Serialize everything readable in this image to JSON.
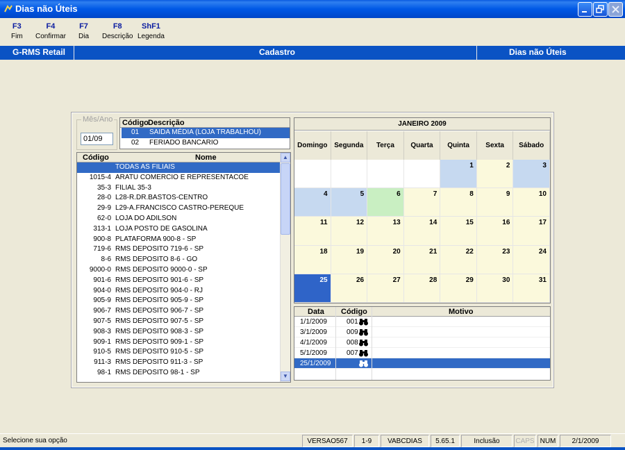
{
  "window": {
    "title": "Dias não Úteis",
    "buttons": [
      "minimize",
      "restore",
      "close"
    ]
  },
  "toolbar": [
    {
      "key": "F3",
      "label": "Fim"
    },
    {
      "key": "F4",
      "label": "Confirmar"
    },
    {
      "key": "F7",
      "label": "Dia"
    },
    {
      "key": "F8",
      "label": "Descrição"
    },
    {
      "key": "ShF1",
      "label": "Legenda"
    }
  ],
  "header": {
    "left": "G-RMS Retail",
    "center": "Cadastro",
    "right": "Dias não Úteis"
  },
  "mesano": {
    "legend": "Mês/Ano",
    "value": "01/09"
  },
  "motivo_tipos": {
    "headers": [
      "Código",
      "Descrição"
    ],
    "rows": [
      {
        "codigo": "01",
        "descricao": "SAIDA MÉDIA (LOJA TRABALHOU)",
        "selected": true
      },
      {
        "codigo": "02",
        "descricao": "FERIADO BANCARIO",
        "selected": false
      }
    ]
  },
  "filiais": {
    "headers": [
      "Código",
      "Nome"
    ],
    "rows": [
      {
        "codigo": "",
        "nome": "TODAS AS FILIAIS",
        "selected": true
      },
      {
        "codigo": "1015-4",
        "nome": "ARATU COMERCIO E REPRESENTACOE"
      },
      {
        "codigo": "35-3",
        "nome": "FILIAL 35-3"
      },
      {
        "codigo": "28-0",
        "nome": "L28-R.DR.BASTOS-CENTRO"
      },
      {
        "codigo": "29-9",
        "nome": "L29-A.FRANCISCO CASTRO-PEREQUE"
      },
      {
        "codigo": "62-0",
        "nome": "LOJA DO ADILSON"
      },
      {
        "codigo": "313-1",
        "nome": "LOJA POSTO DE GASOLINA"
      },
      {
        "codigo": "900-8",
        "nome": "PLATAFORMA 900-8 - SP"
      },
      {
        "codigo": "719-6",
        "nome": "RMS DEPOSITO 719-6 - SP"
      },
      {
        "codigo": "8-6",
        "nome": "RMS DEPOSITO 8-6 - GO"
      },
      {
        "codigo": "9000-0",
        "nome": "RMS DEPOSITO 9000-0 - SP"
      },
      {
        "codigo": "901-6",
        "nome": "RMS DEPOSITO 901-6 - SP"
      },
      {
        "codigo": "904-0",
        "nome": "RMS DEPOSITO 904-0 - RJ"
      },
      {
        "codigo": "905-9",
        "nome": "RMS DEPOSITO 905-9 - SP"
      },
      {
        "codigo": "906-7",
        "nome": "RMS DEPOSITO 906-7 - SP"
      },
      {
        "codigo": "907-5",
        "nome": "RMS DEPOSITO 907-5 - SP"
      },
      {
        "codigo": "908-3",
        "nome": "RMS DEPOSITO 908-3 - SP"
      },
      {
        "codigo": "909-1",
        "nome": "RMS DEPOSITO 909-1 - SP"
      },
      {
        "codigo": "910-5",
        "nome": "RMS DEPOSITO 910-5 - SP"
      },
      {
        "codigo": "911-3",
        "nome": "RMS DEPOSITO 911-3 - SP"
      },
      {
        "codigo": "98-1",
        "nome": "RMS DEPOSITO 98-1 - SP"
      }
    ]
  },
  "calendar": {
    "title": "JANEIRO 2009",
    "daynames": [
      "Domingo",
      "Segunda",
      "Terça",
      "Quarta",
      "Quinta",
      "Sexta",
      "Sábado"
    ],
    "colors": {
      "blue": "#c6d9f0",
      "yellow": "#fbf9dc",
      "green": "#c9efc2",
      "selected": "#2f64c8"
    },
    "days": [
      {
        "d": "",
        "s": "empty"
      },
      {
        "d": "",
        "s": "empty"
      },
      {
        "d": "",
        "s": "empty"
      },
      {
        "d": "",
        "s": "empty"
      },
      {
        "d": "1",
        "s": "blue"
      },
      {
        "d": "2",
        "s": "yellow"
      },
      {
        "d": "3",
        "s": "blue"
      },
      {
        "d": "4",
        "s": "blue"
      },
      {
        "d": "5",
        "s": "blue"
      },
      {
        "d": "6",
        "s": "green"
      },
      {
        "d": "7",
        "s": "yellow"
      },
      {
        "d": "8",
        "s": "yellow"
      },
      {
        "d": "9",
        "s": "yellow"
      },
      {
        "d": "10",
        "s": "yellow"
      },
      {
        "d": "11",
        "s": "yellow"
      },
      {
        "d": "12",
        "s": "yellow"
      },
      {
        "d": "13",
        "s": "yellow"
      },
      {
        "d": "14",
        "s": "yellow"
      },
      {
        "d": "15",
        "s": "yellow"
      },
      {
        "d": "16",
        "s": "yellow"
      },
      {
        "d": "17",
        "s": "yellow"
      },
      {
        "d": "18",
        "s": "yellow"
      },
      {
        "d": "19",
        "s": "yellow"
      },
      {
        "d": "20",
        "s": "yellow"
      },
      {
        "d": "21",
        "s": "yellow"
      },
      {
        "d": "22",
        "s": "yellow"
      },
      {
        "d": "23",
        "s": "yellow"
      },
      {
        "d": "24",
        "s": "yellow"
      },
      {
        "d": "25",
        "s": "sel"
      },
      {
        "d": "26",
        "s": "yellow"
      },
      {
        "d": "27",
        "s": "yellow"
      },
      {
        "d": "28",
        "s": "yellow"
      },
      {
        "d": "29",
        "s": "yellow"
      },
      {
        "d": "30",
        "s": "yellow"
      },
      {
        "d": "31",
        "s": "yellow"
      }
    ]
  },
  "motivos": {
    "headers": [
      "Data",
      "Código",
      "Motivo"
    ],
    "rows": [
      {
        "data": "1/1/2009",
        "codigo": "001",
        "motivo": "",
        "selected": false
      },
      {
        "data": "3/1/2009",
        "codigo": "009",
        "motivo": "",
        "selected": false
      },
      {
        "data": "4/1/2009",
        "codigo": "008",
        "motivo": "",
        "selected": false
      },
      {
        "data": "5/1/2009",
        "codigo": "007",
        "motivo": "",
        "selected": false
      },
      {
        "data": "25/1/2009",
        "codigo": "",
        "motivo": "",
        "selected": true
      }
    ]
  },
  "status": {
    "message": "Selecione sua opção",
    "version": "VERSAO567",
    "range": "1-9",
    "module": "VABCDIAS",
    "build": "5.65.1",
    "mode": "Inclusão",
    "caps": "CAPS",
    "num": "NUM",
    "date": "2/1/2009"
  }
}
